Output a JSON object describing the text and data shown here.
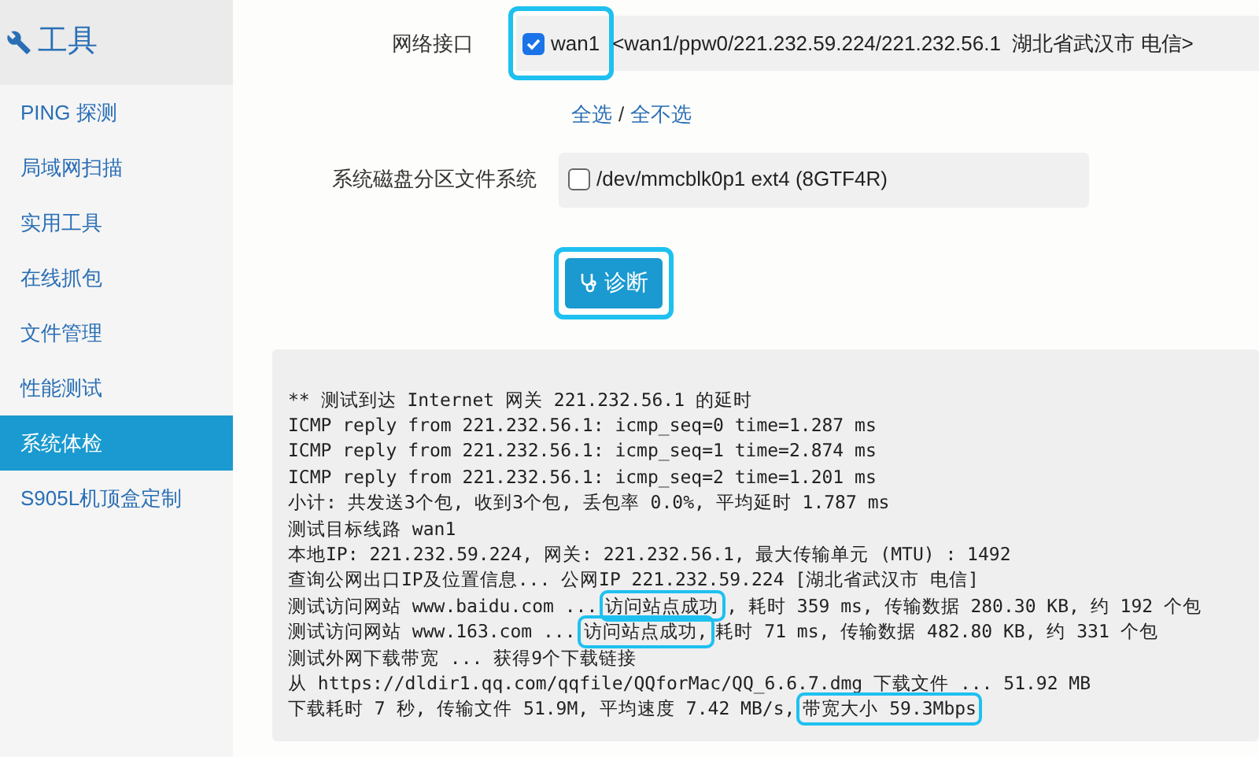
{
  "sidebar": {
    "title": "工具",
    "items": [
      {
        "label": "PING 探测",
        "selected": false
      },
      {
        "label": "局域网扫描",
        "selected": false
      },
      {
        "label": "实用工具",
        "selected": false
      },
      {
        "label": "在线抓包",
        "selected": false
      },
      {
        "label": "文件管理",
        "selected": false
      },
      {
        "label": "性能测试",
        "selected": false
      },
      {
        "label": "系统体检",
        "selected": true
      },
      {
        "label": "S905L机顶盒定制",
        "selected": false
      }
    ]
  },
  "form": {
    "interface": {
      "label": "网络接口",
      "checked": true,
      "highlighted": true,
      "name": "wan1",
      "detail": "<wan1/ppw0/221.232.59.224/221.232.56.1  湖北省武汉市 电信>"
    },
    "select_all": "全选",
    "separator": "/",
    "select_none": "全不选",
    "disk": {
      "label": "系统磁盘分区文件系统",
      "checked": false,
      "name": "/dev/mmcblk0p1 ext4 (8GTF4R)"
    },
    "button": {
      "label": "诊断",
      "highlighted": true
    }
  },
  "log": [
    [
      {
        "text": "** 测试到达 Internet 网关 221.232.56.1 的延时",
        "highlighted": false
      }
    ],
    [
      {
        "text": "ICMP reply from 221.232.56.1: icmp_seq=0 time=1.287 ms",
        "highlighted": false
      }
    ],
    [
      {
        "text": "ICMP reply from 221.232.56.1: icmp_seq=1 time=2.874 ms",
        "highlighted": false
      }
    ],
    [
      {
        "text": "ICMP reply from 221.232.56.1: icmp_seq=2 time=1.201 ms",
        "highlighted": false
      }
    ],
    [
      {
        "text": "小计: 共发送3个包, 收到3个包, 丢包率 0.0%, 平均延时 1.787 ms",
        "highlighted": false
      }
    ],
    [
      {
        "text": "测试目标线路 wan1",
        "highlighted": false
      }
    ],
    [
      {
        "text": "本地IP: 221.232.59.224, 网关: 221.232.56.1, 最大传输单元 (MTU) : 1492",
        "highlighted": false
      }
    ],
    [
      {
        "text": "查询公网出口IP及位置信息... 公网IP 221.232.59.224 [湖北省武汉市 电信]",
        "highlighted": false
      }
    ],
    [
      {
        "text": "测试访问网站 www.baidu.com ...",
        "highlighted": false
      },
      {
        "text": "访问站点成功",
        "highlighted": true
      },
      {
        "text": ", 耗时 359 ms, 传输数据 280.30 KB, 约 192 个包",
        "highlighted": false
      }
    ],
    [
      {
        "text": "测试访问网站 www.163.com ...",
        "highlighted": false
      },
      {
        "text": "访问站点成功,",
        "highlighted": true
      },
      {
        "text": "耗时 71 ms, 传输数据 482.80 KB, 约 331 个包",
        "highlighted": false
      }
    ],
    [
      {
        "text": "测试外网下载带宽 ... 获得9个下载链接",
        "highlighted": false
      }
    ],
    [
      {
        "text": "从 https://dldir1.qq.com/qqfile/QQforMac/QQ_6.6.7.dmg 下载文件 ... 51.92 MB",
        "highlighted": false
      }
    ],
    [
      {
        "text": "下载耗时 7 秒, 传输文件 51.9M, 平均速度 7.42 MB/s,",
        "highlighted": false
      },
      {
        "text": "带宽大小 59.3Mbps",
        "highlighted": true
      }
    ]
  ]
}
